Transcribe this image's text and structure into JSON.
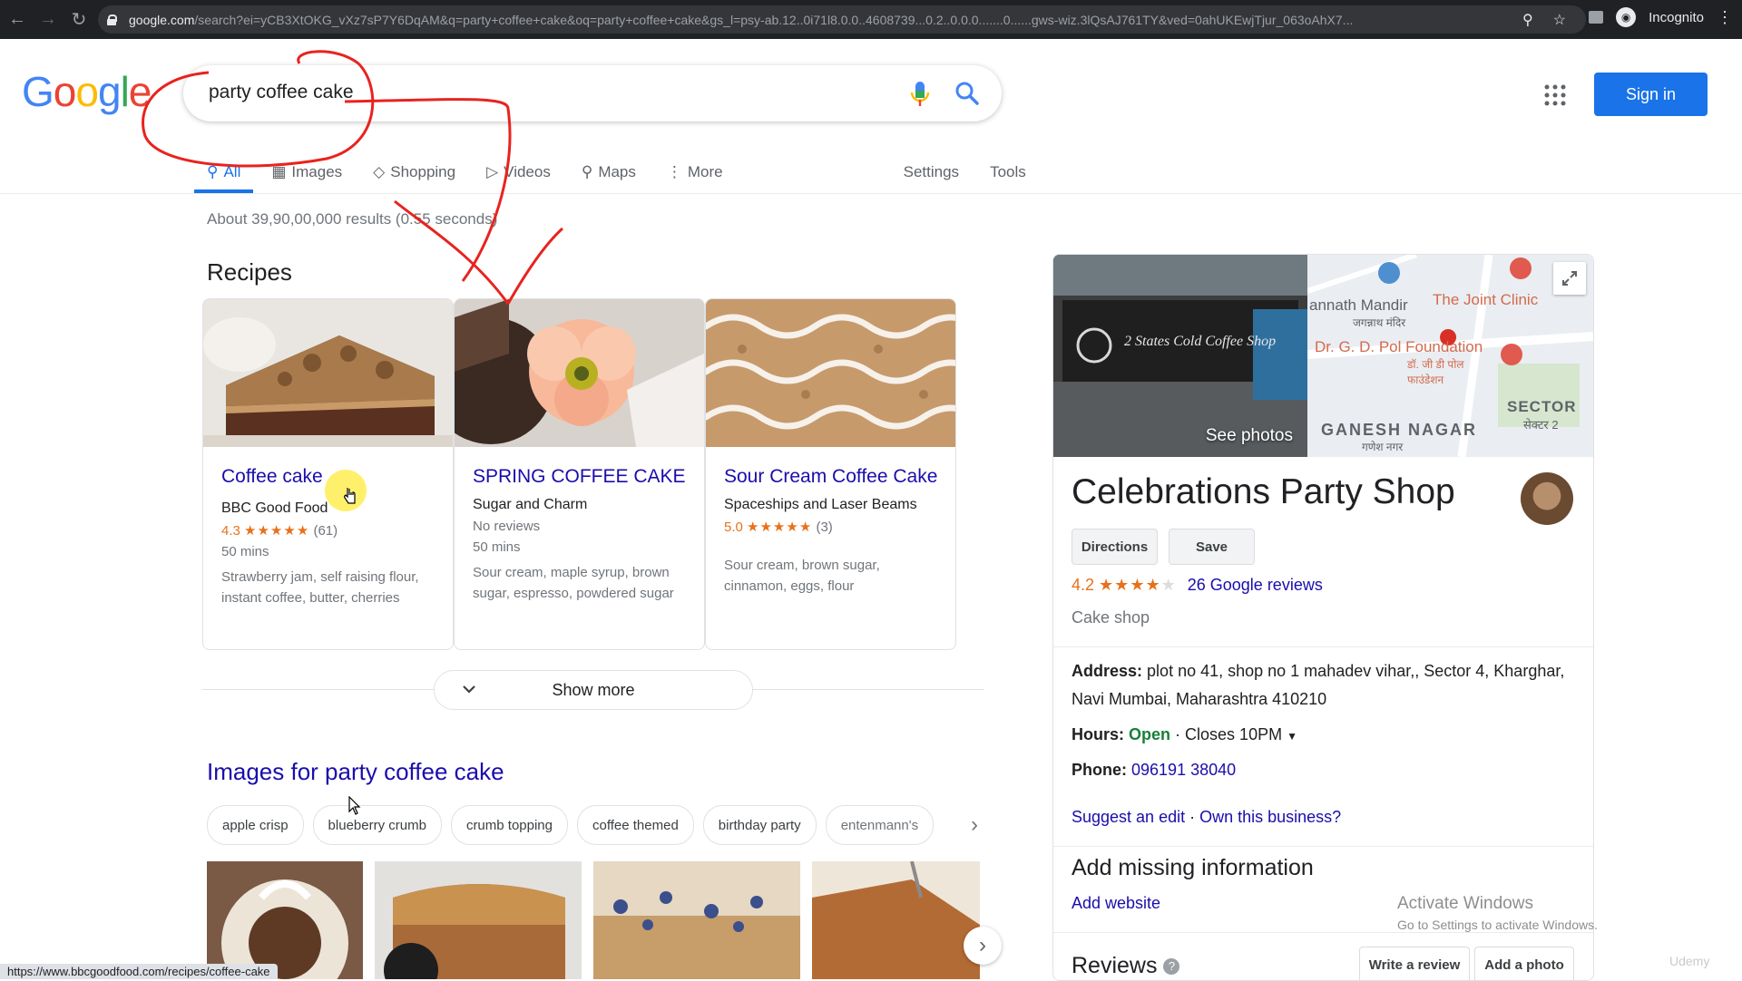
{
  "browser": {
    "url_domain": "google.com",
    "url_rest": "/search?ei=yCB3XtOKG_vXz7sP7Y6DqAM&q=party+coffee+cake&oq=party+coffee+cake&gs_l=psy-ab.12..0i71l8.0.0..4608739...0.2..0.0.0.......0......gws-wiz.3lQsAJ761TY&ved=0ahUKEwjTjur_063oAhX7...",
    "profile_label": "Incognito"
  },
  "search": {
    "query": "party coffee cake",
    "signin_label": "Sign in"
  },
  "tabs": [
    {
      "label": "All"
    },
    {
      "label": "Images"
    },
    {
      "label": "Shopping"
    },
    {
      "label": "Videos"
    },
    {
      "label": "Maps"
    },
    {
      "label": "More"
    },
    {
      "label": "Settings"
    },
    {
      "label": "Tools"
    }
  ],
  "result_stats": "About 39,90,00,000 results (0.55 seconds)",
  "recipes": {
    "title": "Recipes",
    "cards": [
      {
        "title": "Coffee cake",
        "source": "BBC Good Food",
        "rating": "4.3",
        "stars": "★★★★★",
        "reviews": "(61)",
        "time": "50 mins",
        "ingredients": "Strawberry jam, self raising flour, instant coffee, butter, cherries"
      },
      {
        "title": "SPRING COFFEE CAKE",
        "source": "Sugar and Charm",
        "no_reviews": "No reviews",
        "time": "50 mins",
        "ingredients": "Sour cream, maple syrup, brown sugar, espresso, powdered sugar"
      },
      {
        "title": "Sour Cream Coffee Cake",
        "source": "Spaceships and Laser Beams",
        "rating": "5.0",
        "stars": "★★★★★",
        "reviews": "(3)",
        "ingredients": "Sour cream, brown sugar, cinnamon, eggs, flour"
      }
    ],
    "show_more": "Show more"
  },
  "images_section": {
    "title": "Images for party coffee cake",
    "chips": [
      "apple crisp",
      "blueberry crumb",
      "crumb topping",
      "coffee themed",
      "birthday party",
      "entenmann's"
    ]
  },
  "knowledge_panel": {
    "see_photos": "See photos",
    "map_labels": {
      "mandir": "annath Mandir",
      "mandir_hindi": "जगन्नाथ मंदिर",
      "clinic": "The Joint Clinic",
      "foundation": "Dr. G. D. Pol Foundation",
      "foundation_hindi": "डॉ. जी डी पोल फाउंडेशन",
      "sector": "SECTOR",
      "sector_hindi": "सेक्टर 2",
      "ganesh": "GANESH NAGAR",
      "ganesh_hindi": "गणेश नगर"
    },
    "shop_sign": "2 States Cold Coffee Shop",
    "title": "Celebrations Party Shop",
    "directions_label": "Directions",
    "save_label": "Save",
    "rating": "4.2",
    "stars": "★★★★",
    "empty_star": "★",
    "reviews_link": "26 Google reviews",
    "category": "Cake shop",
    "address_label": "Address:",
    "address": "plot no 41, shop no 1 mahadev vihar,, Sector 4, Kharghar, Navi Mumbai, Maharashtra 410210",
    "hours_label": "Hours:",
    "hours_open": "Open",
    "hours_close": "Closes 10PM",
    "phone_label": "Phone:",
    "phone": "096191 38040",
    "suggest_edit": "Suggest an edit",
    "own_business": "Own this business?",
    "missing_title": "Add missing information",
    "add_website": "Add website",
    "reviews_title": "Reviews",
    "write_review": "Write a review",
    "add_photo": "Add a photo"
  },
  "overlay": {
    "activate_title": "Activate Windows",
    "activate_sub": "Go to Settings to activate Windows.",
    "status_url": "https://www.bbcgoodfood.com/recipes/coffee-cake",
    "watermark": "Udemy"
  },
  "colors": {
    "link": "#1a0dab",
    "accent": "#1a73e8",
    "rating": "#e7711b",
    "open": "#188038",
    "annotation": "#e8231e"
  }
}
